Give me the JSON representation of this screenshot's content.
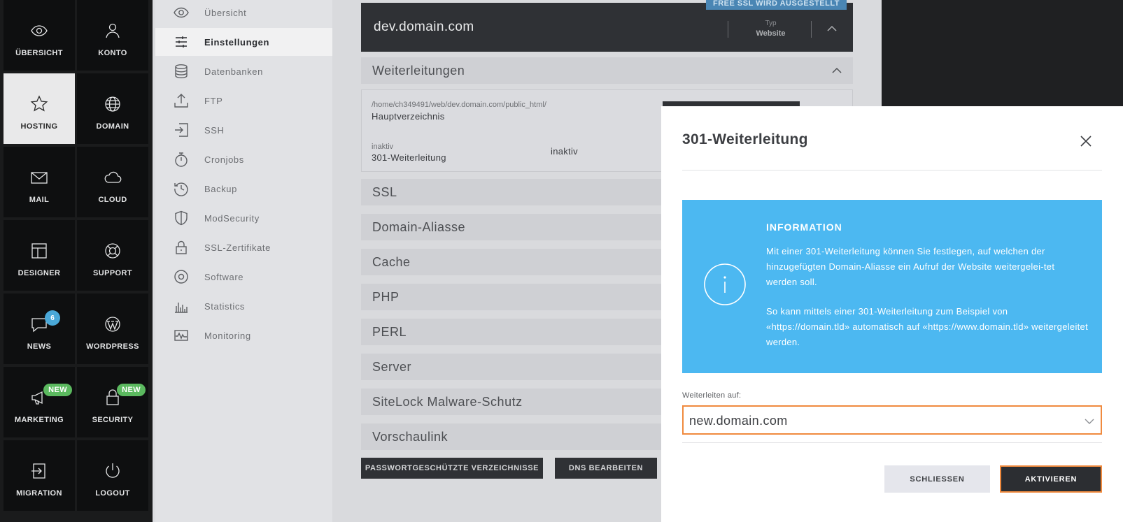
{
  "tilenav": {
    "tiles": [
      {
        "label": "ÜBERSICHT",
        "icon": "eye-icon"
      },
      {
        "label": "KONTO",
        "icon": "user-icon"
      },
      {
        "label": "HOSTING",
        "icon": "star-icon",
        "active": true
      },
      {
        "label": "DOMAIN",
        "icon": "globe-icon"
      },
      {
        "label": "MAIL",
        "icon": "mail-icon"
      },
      {
        "label": "CLOUD",
        "icon": "cloud-icon"
      },
      {
        "label": "DESIGNER",
        "icon": "layout-icon"
      },
      {
        "label": "SUPPORT",
        "icon": "lifebuoy-icon"
      },
      {
        "label": "NEWS",
        "icon": "chat-bubble-icon",
        "badge": "6"
      },
      {
        "label": "WORDPRESS",
        "icon": "wordpress-icon"
      },
      {
        "label": "MARKETING",
        "icon": "megaphone-icon",
        "badge": "NEW"
      },
      {
        "label": "SECURITY",
        "icon": "padlock-icon",
        "badge": "NEW"
      },
      {
        "label": "MIGRATION",
        "icon": "migration-icon"
      },
      {
        "label": "LOGOUT",
        "icon": "power-icon"
      }
    ]
  },
  "submenu": {
    "items": [
      {
        "label": "Übersicht",
        "icon": "eye-icon"
      },
      {
        "label": "Einstellungen",
        "icon": "sliders-icon",
        "active": true
      },
      {
        "label": "Datenbanken",
        "icon": "database-icon"
      },
      {
        "label": "FTP",
        "icon": "upload-icon"
      },
      {
        "label": "SSH",
        "icon": "login-icon"
      },
      {
        "label": "Cronjobs",
        "icon": "stopwatch-icon"
      },
      {
        "label": "Backup",
        "icon": "history-icon"
      },
      {
        "label": "ModSecurity",
        "icon": "shield-icon"
      },
      {
        "label": "SSL-Zertifikate",
        "icon": "certificate-lock-icon"
      },
      {
        "label": "Software",
        "icon": "disc-icon"
      },
      {
        "label": "Statistics",
        "icon": "bar-chart-icon"
      },
      {
        "label": "Monitoring",
        "icon": "pulse-icon"
      }
    ]
  },
  "main": {
    "ssl_badge": "FREE SSL WIRD AUSGESTELLT",
    "domain_name": "dev.domain.com",
    "type_label": "Typ",
    "type_value": "Website",
    "redirect_section": "Weiterleitungen",
    "redirect_path": "/home/ch349491/web/dev.domain.com/public_html/",
    "redirect_main": "Hauptverzeichnis",
    "redirect_status_small": "inaktiv",
    "redirect_name": "301-Weiterleitung",
    "redirect_status": "inaktiv",
    "sections": [
      "SSL",
      "Domain-Aliasse",
      "Cache",
      "PHP",
      "PERL",
      "Server",
      "SiteLock Malware-Schutz",
      "Vorschaulink"
    ],
    "buttons": [
      "PASSWORTGESCHÜTZTE VERZEICHNISSE",
      "DNS BEARBEITEN"
    ]
  },
  "modal": {
    "title": "301-Weiterleitung",
    "info_title": "INFORMATION",
    "info_text_1": "Mit einer 301-Weiterleitung können Sie festlegen, auf welchen der hinzugefügten Domain-Aliasse ein Aufruf der Website weitergelei-tet werden soll.",
    "info_text_2": "So kann mittels einer 301-Weiterleitung zum Beispiel von «https://domain.tld» automatisch auf «https://www.domain.tld» weitergeleitet werden.",
    "field_label": "Weiterleiten auf:",
    "field_value": "new.domain.com",
    "close_label": "SCHLIESSEN",
    "activate_label": "AKTIVIEREN"
  },
  "colors": {
    "info_blue": "#4cb8f1",
    "focus_orange": "#f08a3e",
    "dark": "#2f3135",
    "badge_green": "#5bb95f"
  }
}
